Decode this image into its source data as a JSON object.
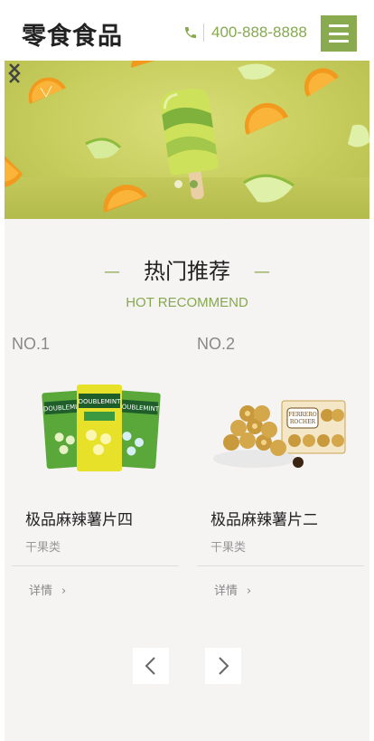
{
  "header": {
    "logo": "零食食品",
    "phone": "400-888-8888",
    "phone_icon": "phone-icon",
    "menu_icon": "hamburger-menu-icon"
  },
  "banner": {
    "prev_icon": "chevron-left-icon",
    "next_icon": "chevron-right-icon",
    "slide_count": 2,
    "active_slide": 2
  },
  "section": {
    "title": "热门推荐",
    "subtitle": "HOT RECOMMEND",
    "dash": "—"
  },
  "products": [
    {
      "no": "NO.1",
      "name": "极品麻辣薯片四",
      "category": "干果类",
      "detail": "详情",
      "image": "doublemint-gum-packs"
    },
    {
      "no": "NO.2",
      "name": "极品麻辣薯片二",
      "category": "干果类",
      "detail": "详情",
      "image": "ferrero-rocher-chocolates"
    }
  ],
  "pager": {
    "prev_icon": "chevron-left-icon",
    "next_icon": "chevron-right-icon"
  },
  "colors": {
    "accent": "#8aaa4f",
    "accent_text": "#86a94f",
    "section_bg": "#f6f3f3"
  }
}
